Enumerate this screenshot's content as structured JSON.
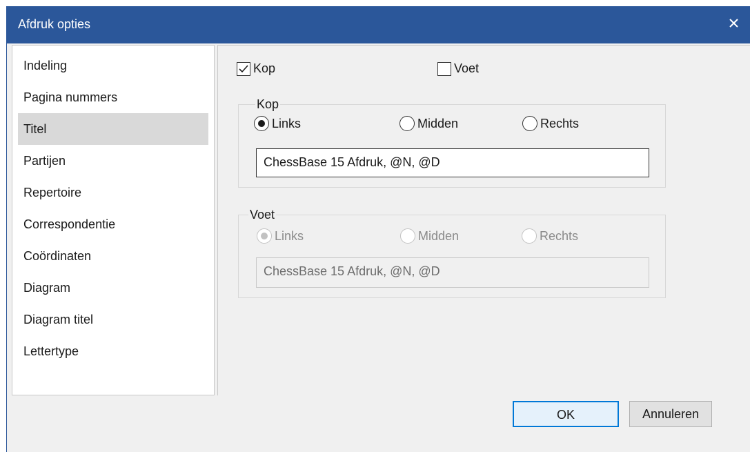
{
  "window": {
    "title": "Afdruk opties",
    "close_glyph": "×"
  },
  "sidebar": {
    "items": [
      {
        "label": "Indeling"
      },
      {
        "label": "Pagina nummers"
      },
      {
        "label": "Titel",
        "selected": true
      },
      {
        "label": "Partijen"
      },
      {
        "label": "Repertoire"
      },
      {
        "label": "Correspondentie"
      },
      {
        "label": "Coördinaten"
      },
      {
        "label": "Diagram"
      },
      {
        "label": "Diagram titel"
      },
      {
        "label": "Lettertype"
      }
    ]
  },
  "options": {
    "header_checkbox": {
      "label": "Kop",
      "checked": true
    },
    "footer_checkbox": {
      "label": "Voet",
      "checked": false
    }
  },
  "header_group": {
    "legend": "Kop",
    "radios": {
      "left": "Links",
      "center": "Midden",
      "right": "Rechts"
    },
    "selected": "Links",
    "text": "ChessBase 15 Afdruk, @N, @D"
  },
  "footer_group": {
    "legend": "Voet",
    "radios": {
      "left": "Links",
      "center": "Midden",
      "right": "Rechts"
    },
    "selected": "Links",
    "text": "ChessBase 15 Afdruk, @N, @D",
    "disabled": true
  },
  "buttons": {
    "ok": "OK",
    "cancel": "Annuleren"
  },
  "colors": {
    "titlebar": "#2b579a",
    "selected_item": "#d9d9d9",
    "ok_border": "#0078d7"
  }
}
